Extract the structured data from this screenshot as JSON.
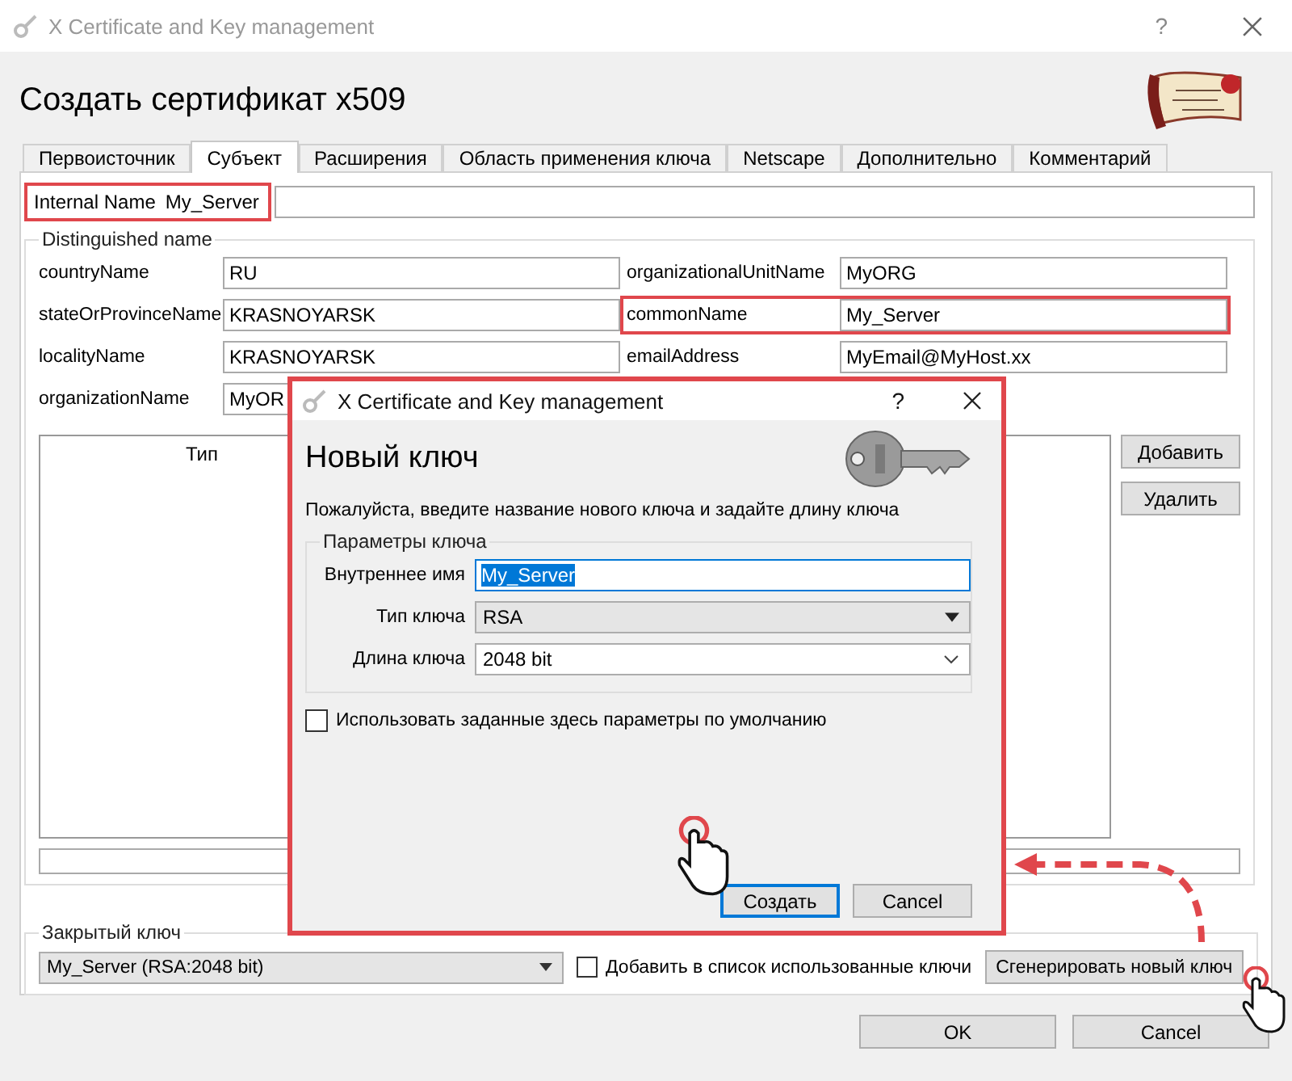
{
  "window": {
    "title": "X Certificate and Key management",
    "help": "?"
  },
  "heading": "Создать сертификат x509",
  "tabs": [
    {
      "label": "Первоисточник",
      "selected": false
    },
    {
      "label": "Субъект",
      "selected": true
    },
    {
      "label": "Расширения",
      "selected": false
    },
    {
      "label": "Область применения ключа",
      "selected": false
    },
    {
      "label": "Netscape",
      "selected": false
    },
    {
      "label": "Дополнительно",
      "selected": false
    },
    {
      "label": "Комментарий",
      "selected": false
    }
  ],
  "internal_name": {
    "label": "Internal Name",
    "value": "My_Server",
    "highlighted": true
  },
  "distinguished_name": {
    "title": "Distinguished name",
    "left_fields": [
      {
        "label": "countryName",
        "value": "RU",
        "highlighted": false
      },
      {
        "label": "stateOrProvinceName",
        "value": "KRASNOYARSK",
        "highlighted": false
      },
      {
        "label": "localityName",
        "value": "KRASNOYARSK",
        "highlighted": false
      },
      {
        "label": "organizationName",
        "value": "MyOR",
        "highlighted": false
      }
    ],
    "right_fields": [
      {
        "label": "organizationalUnitName",
        "value": "MyORG",
        "highlighted": false
      },
      {
        "label": "commonName",
        "value": "My_Server",
        "highlighted": true
      },
      {
        "label": "emailAddress",
        "value": "MyEmail@MyHost.xx",
        "highlighted": false
      }
    ],
    "table": {
      "columns": [
        "Тип"
      ]
    },
    "table_buttons": [
      "Добавить",
      "Удалить"
    ]
  },
  "private_key": {
    "title": "Закрытый ключ",
    "key": "My_Server (RSA:2048 bit)",
    "use_checkbox": {
      "label": "Добавить в список использованные ключи",
      "checked": false
    },
    "generate_button": "Сгенерировать новый ключ"
  },
  "buttons": [
    "OK",
    "Cancel"
  ],
  "dialog": {
    "title": "X Certificate and Key management",
    "help": "?",
    "heading": "Новый ключ",
    "description": "Пожалуйста, введите название нового ключа и задайте длину ключа",
    "group_title": "Параметры ключа",
    "name_label": "Внутреннее имя",
    "name_value": "My_Server",
    "name_selected": true,
    "type_label": "Тип ключа",
    "type_value": "RSA",
    "length_label": "Длина ключа",
    "length_value": "2048 bit",
    "default_checkbox": {
      "label": "Использовать заданные здесь параметры по умолчанию",
      "checked": false
    },
    "buttons": [
      {
        "label": "Создать",
        "focused": true
      },
      {
        "label": "Cancel",
        "focused": false
      }
    ]
  }
}
